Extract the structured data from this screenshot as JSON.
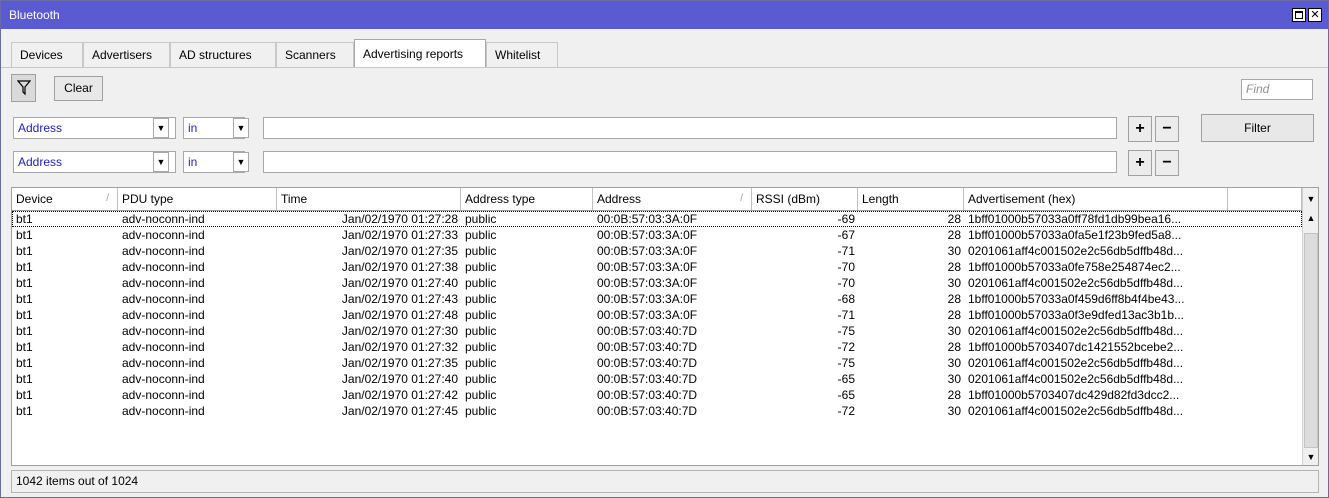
{
  "window": {
    "title": "Bluetooth"
  },
  "tabs": [
    "Devices",
    "Advertisers",
    "AD structures",
    "Scanners",
    "Advertising reports",
    "Whitelist"
  ],
  "active_tab": "Advertising reports",
  "toolbar": {
    "clear_label": "Clear",
    "find_placeholder": "Find"
  },
  "filters": [
    {
      "field": "Address",
      "operator": "in",
      "value": ""
    },
    {
      "field": "Address",
      "operator": "in",
      "value": ""
    }
  ],
  "filter_button": "Filter",
  "table": {
    "columns": [
      "Device",
      "PDU type",
      "Time",
      "Address type",
      "Address",
      "RSSI (dBm)",
      "Length",
      "Advertisement (hex)"
    ],
    "rows": [
      [
        "bt1",
        "adv-noconn-ind",
        "Jan/02/1970 01:27:28",
        "public",
        "00:0B:57:03:3A:0F",
        "-69",
        "28",
        "1bff01000b57033a0ff78fd1db99bea16..."
      ],
      [
        "bt1",
        "adv-noconn-ind",
        "Jan/02/1970 01:27:33",
        "public",
        "00:0B:57:03:3A:0F",
        "-67",
        "28",
        "1bff01000b57033a0fa5e1f23b9fed5a8..."
      ],
      [
        "bt1",
        "adv-noconn-ind",
        "Jan/02/1970 01:27:35",
        "public",
        "00:0B:57:03:3A:0F",
        "-71",
        "30",
        "0201061aff4c001502e2c56db5dffb48d..."
      ],
      [
        "bt1",
        "adv-noconn-ind",
        "Jan/02/1970 01:27:38",
        "public",
        "00:0B:57:03:3A:0F",
        "-70",
        "28",
        "1bff01000b57033a0fe758e254874ec2..."
      ],
      [
        "bt1",
        "adv-noconn-ind",
        "Jan/02/1970 01:27:40",
        "public",
        "00:0B:57:03:3A:0F",
        "-70",
        "30",
        "0201061aff4c001502e2c56db5dffb48d..."
      ],
      [
        "bt1",
        "adv-noconn-ind",
        "Jan/02/1970 01:27:43",
        "public",
        "00:0B:57:03:3A:0F",
        "-68",
        "28",
        "1bff01000b57033a0f459d6ff8b4f4be43..."
      ],
      [
        "bt1",
        "adv-noconn-ind",
        "Jan/02/1970 01:27:48",
        "public",
        "00:0B:57:03:3A:0F",
        "-71",
        "28",
        "1bff01000b57033a0f3e9dfed13ac3b1b..."
      ],
      [
        "bt1",
        "adv-noconn-ind",
        "Jan/02/1970 01:27:30",
        "public",
        "00:0B:57:03:40:7D",
        "-75",
        "30",
        "0201061aff4c001502e2c56db5dffb48d..."
      ],
      [
        "bt1",
        "adv-noconn-ind",
        "Jan/02/1970 01:27:32",
        "public",
        "00:0B:57:03:40:7D",
        "-72",
        "28",
        "1bff01000b5703407dc1421552bcebe2..."
      ],
      [
        "bt1",
        "adv-noconn-ind",
        "Jan/02/1970 01:27:35",
        "public",
        "00:0B:57:03:40:7D",
        "-75",
        "30",
        "0201061aff4c001502e2c56db5dffb48d..."
      ],
      [
        "bt1",
        "adv-noconn-ind",
        "Jan/02/1970 01:27:40",
        "public",
        "00:0B:57:03:40:7D",
        "-65",
        "30",
        "0201061aff4c001502e2c56db5dffb48d..."
      ],
      [
        "bt1",
        "adv-noconn-ind",
        "Jan/02/1970 01:27:42",
        "public",
        "00:0B:57:03:40:7D",
        "-65",
        "28",
        "1bff01000b5703407dc429d82fd3dcc2..."
      ],
      [
        "bt1",
        "adv-noconn-ind",
        "Jan/02/1970 01:27:45",
        "public",
        "00:0B:57:03:40:7D",
        "-72",
        "30",
        "0201061aff4c001502e2c56db5dffb48d..."
      ]
    ]
  },
  "status": "1042 items out of 1024",
  "colors": {
    "titlebar": "#5a5ad2",
    "link_text": "#2020d0"
  },
  "icons": [
    "filter-icon",
    "minimize-icon",
    "close-icon",
    "dropdown-icon",
    "plus-icon",
    "minus-icon",
    "column-menu-icon",
    "scroll-up-icon",
    "scroll-down-icon"
  ]
}
